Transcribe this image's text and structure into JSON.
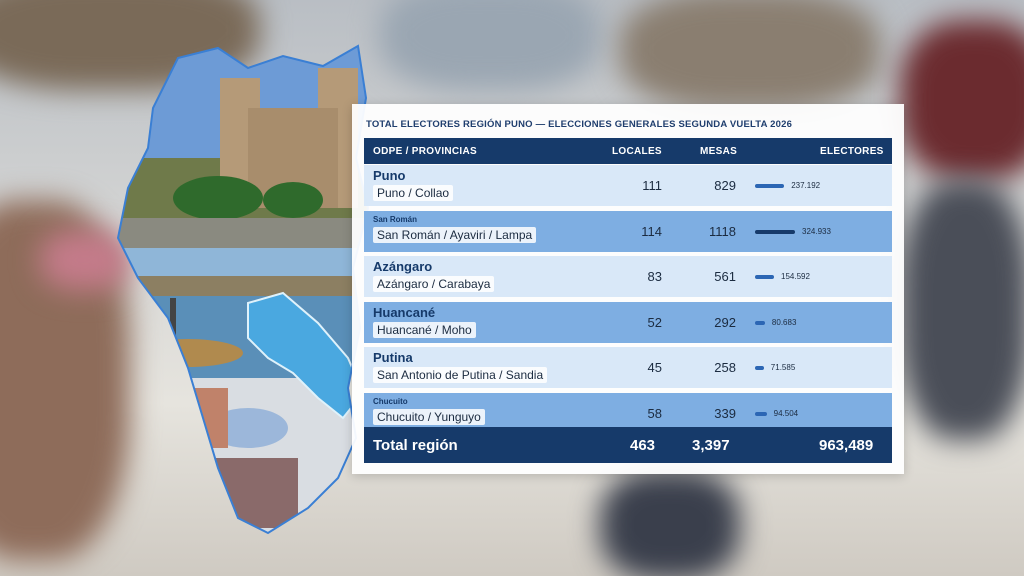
{
  "panel": {
    "title": "TOTAL ELECTORES REGIÓN PUNO — ELECCIONES GENERALES SEGUNDA VUELTA 2026",
    "headers": {
      "odpe": "ODPE / PROVINCIAS",
      "locales": "LOCALES",
      "mesas": "MESAS",
      "electores": "ELECTORES"
    },
    "rows": [
      {
        "name": "Puno",
        "sub": "Puno / Collao",
        "locales": "111",
        "mesas": "829",
        "electores": "237.192",
        "electores_value": 237192,
        "name_small": false
      },
      {
        "name": "San Román",
        "sub": "San Román / Ayaviri / Lampa",
        "locales": "114",
        "mesas": "1118",
        "electores": "324.933",
        "electores_value": 324933,
        "name_small": true
      },
      {
        "name": "Azángaro",
        "sub": "Azángaro / Carabaya",
        "locales": "83",
        "mesas": "561",
        "electores": "154.592",
        "electores_value": 154592,
        "name_small": false
      },
      {
        "name": "Huancané",
        "sub": "Huancané / Moho",
        "locales": "52",
        "mesas": "292",
        "electores": "80.683",
        "electores_value": 80683,
        "name_small": false
      },
      {
        "name": "Putina",
        "sub": "San Antonio de Putina / Sandia",
        "locales": "45",
        "mesas": "258",
        "electores": "71.585",
        "electores_value": 71585,
        "name_small": false
      },
      {
        "name": "Chucuito",
        "sub": "Chucuito / Yunguyo",
        "locales": "58",
        "mesas": "339",
        "electores": "94.504",
        "electores_value": 94504,
        "name_small": true
      }
    ],
    "total": {
      "label": "Total región",
      "locales": "463",
      "mesas": "3,397",
      "electores": "963,489"
    }
  },
  "colors": {
    "navy": "#163a6a",
    "row_light": "#d6e6f7",
    "row_dark": "#7eaee2",
    "lake": "#4aa8e0"
  }
}
